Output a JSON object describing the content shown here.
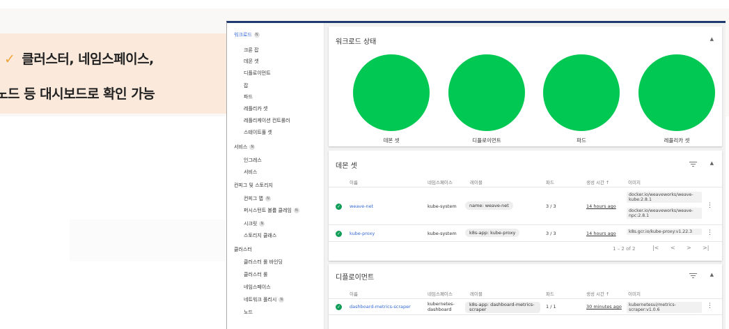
{
  "callout": {
    "line1": "클러스터, 네임스페이스,",
    "line2": "노드 등 대시보드로 확인 가능",
    "check": "✓"
  },
  "sidebar": {
    "items": [
      {
        "label": "워크로드",
        "badge": "N",
        "level": "section",
        "active": true
      },
      {
        "label": "크론 잡",
        "level": "sub"
      },
      {
        "label": "데몬 셋",
        "level": "sub"
      },
      {
        "label": "디플로이먼트",
        "level": "sub"
      },
      {
        "label": "잡",
        "level": "sub"
      },
      {
        "label": "파드",
        "level": "sub"
      },
      {
        "label": "레플리카 셋",
        "level": "sub"
      },
      {
        "label": "레플리케이션 컨트롤러",
        "level": "sub"
      },
      {
        "label": "스테이트풀 셋",
        "level": "sub"
      },
      {
        "label": "서비스",
        "badge": "N",
        "level": "section"
      },
      {
        "label": "인그레스",
        "level": "sub"
      },
      {
        "label": "서비스",
        "level": "sub"
      },
      {
        "label": "컨피그 및 스토리지",
        "level": "section"
      },
      {
        "label": "컨피그 맵",
        "badge": "N",
        "level": "sub"
      },
      {
        "label": "퍼시스턴트 볼륨 클레임",
        "badge": "N",
        "level": "sub"
      },
      {
        "label": "시크릿",
        "badge": "N",
        "level": "sub"
      },
      {
        "label": "스토리지 클래스",
        "level": "sub"
      },
      {
        "label": "클러스터",
        "level": "section"
      },
      {
        "label": "클러스터 롤 바인딩",
        "level": "sub"
      },
      {
        "label": "클러스터 롤",
        "level": "sub"
      },
      {
        "label": "네임스페이스",
        "level": "sub"
      },
      {
        "label": "네트워크 폴리시",
        "badge": "N",
        "level": "sub"
      },
      {
        "label": "노드",
        "level": "sub"
      }
    ]
  },
  "workload_status": {
    "title": "워크로드 상태",
    "collapse_icon": "chevron-up-icon",
    "status_color": "#00c853",
    "charts": [
      {
        "label": "데몬 셋"
      },
      {
        "label": "디플로이먼트"
      },
      {
        "label": "파드"
      },
      {
        "label": "레플리카 셋"
      }
    ]
  },
  "daemonsets": {
    "title": "데몬 셋",
    "columns": [
      "이름",
      "네임스페이스",
      "레이블",
      "파드",
      "생성 시간 ↑",
      "이미지"
    ],
    "rows": [
      {
        "name": "weave-net",
        "namespace": "kube-system",
        "label": "name: weave-net",
        "pods": "3 / 3",
        "age": "14 hours ago",
        "images": [
          "docker.io/weaveworks/weave-kube:2.8.1",
          "docker.io/weaveworks/weave-npc:2.8.1"
        ]
      },
      {
        "name": "kube-proxy",
        "namespace": "kube-system",
        "label": "k8s-app: kube-proxy",
        "pods": "3 / 3",
        "age": "14 hours ago",
        "images": [
          "k8s.gcr.io/kube-proxy:v1.22.3"
        ]
      }
    ],
    "pager": "1 – 2 of 2",
    "pager_buttons": [
      "|<",
      "<",
      ">",
      ">|"
    ]
  },
  "deployments": {
    "title": "디플로이먼트",
    "columns": [
      "이름",
      "네임스페이스",
      "레이블",
      "파드",
      "생성 시간 ↑",
      "이미지"
    ],
    "rows": [
      {
        "name": "dashboard-metrics-scraper",
        "namespace": "kubernetes-dashboard",
        "label": "k8s-app: dashboard-metrics-scraper",
        "pods": "1 / 1",
        "age": "30 minutes ago",
        "images": [
          "kubernetesui/metrics-scraper:v1.0.6"
        ]
      }
    ]
  }
}
